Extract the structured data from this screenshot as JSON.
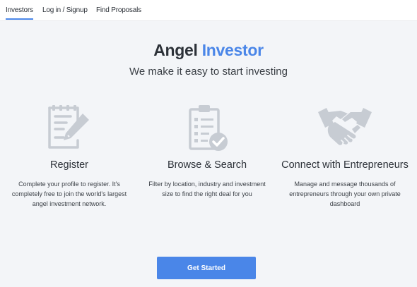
{
  "nav": {
    "items": [
      {
        "label": "Investors",
        "active": true
      },
      {
        "label": "Log in / Signup",
        "active": false
      },
      {
        "label": "Find Proposals",
        "active": false
      }
    ]
  },
  "hero": {
    "title_part1": "Angel",
    "title_part2": "Investor",
    "subtitle": "We make it easy to start investing"
  },
  "features": [
    {
      "icon": "document-pencil-icon",
      "title": "Register",
      "description": "Complete your profile to register. It's completely free to join the world's largest angel investment network."
    },
    {
      "icon": "clipboard-check-icon",
      "title": "Browse & Search",
      "description": "Filter by location, industry and investment size to find the right deal for you"
    },
    {
      "icon": "handshake-icon",
      "title": "Connect with Entrepreneurs",
      "description": "Manage and message thousands of entrepreneurs through your own private dashboard"
    }
  ],
  "cta": {
    "label": "Get Started"
  },
  "colors": {
    "accent": "#4a86e8",
    "icon_gray": "#c7ccd3",
    "background": "#f3f5f8",
    "text": "#2c3138"
  }
}
